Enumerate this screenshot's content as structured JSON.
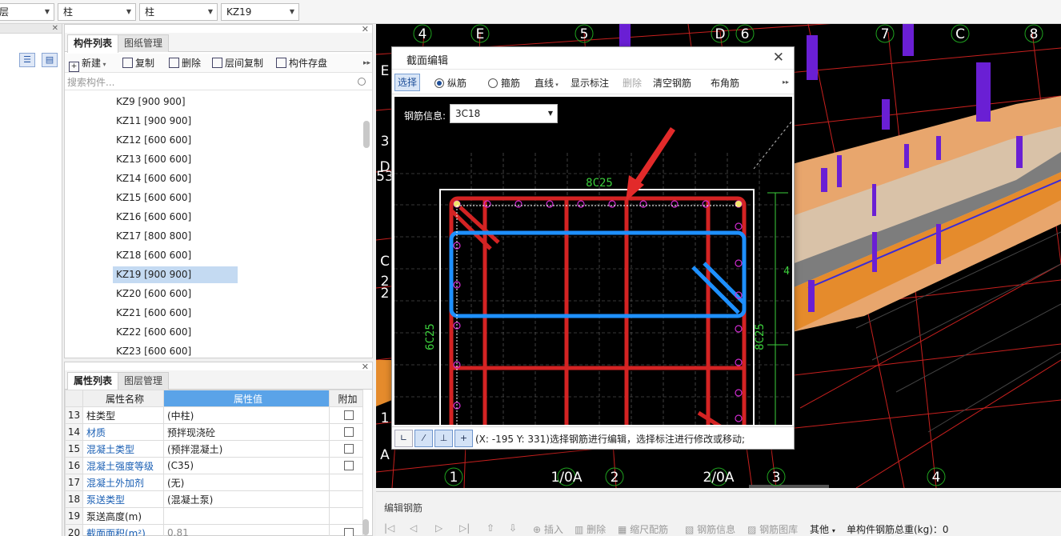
{
  "filters": {
    "combo1": "层",
    "combo2": "柱",
    "combo3": "柱",
    "combo4": "KZ19"
  },
  "component_panel": {
    "tabs": [
      "构件列表",
      "图纸管理"
    ],
    "toolbar": {
      "new": "新建",
      "copy": "复制",
      "delete": "删除",
      "layer_copy": "层间复制",
      "save": "构件存盘"
    },
    "search_placeholder": "搜索构件...",
    "items": [
      "KZ9 [900 900]",
      "KZ11 [900 900]",
      "KZ12 [600 600]",
      "KZ13 [600 600]",
      "KZ14 [600 600]",
      "KZ15 [600 600]",
      "KZ16 [600 600]",
      "KZ17 [800 800]",
      "KZ18 [600 600]",
      "KZ19 [900 900]",
      "KZ20 [600 600]",
      "KZ21 [600 600]",
      "KZ22 [600 600]",
      "KZ23 [600 600]"
    ],
    "selected_index": 9
  },
  "property_panel": {
    "tabs": [
      "属性列表",
      "图层管理"
    ],
    "headers": [
      "属性名称",
      "属性值",
      "附加"
    ],
    "rows": [
      {
        "num": "13",
        "name": "柱类型",
        "value": "(中柱)",
        "link": false,
        "checkbox": true
      },
      {
        "num": "14",
        "name": "材质",
        "value": "预拌现浇砼",
        "link": true,
        "checkbox": true
      },
      {
        "num": "15",
        "name": "混凝土类型",
        "value": "(预拌混凝土)",
        "link": true,
        "checkbox": true
      },
      {
        "num": "16",
        "name": "混凝土强度等级",
        "value": "(C35)",
        "link": true,
        "checkbox": true
      },
      {
        "num": "17",
        "name": "混凝土外加剂",
        "value": "(无)",
        "link": true,
        "checkbox": false
      },
      {
        "num": "18",
        "name": "泵送类型",
        "value": "(混凝土泵)",
        "link": true,
        "checkbox": false
      },
      {
        "num": "19",
        "name": "泵送高度(m)",
        "value": "",
        "link": false,
        "checkbox": false
      },
      {
        "num": "20",
        "name": "截面面积(m²)",
        "value": "0.81",
        "link": true,
        "checkbox": true
      }
    ]
  },
  "viewport": {
    "top_axis_labels": [
      "4",
      "E",
      "5",
      "D",
      "6",
      "7",
      "C",
      "8"
    ],
    "bottom_axis_labels": [
      "1",
      "1/0A",
      "2",
      "2/0A",
      "3",
      "4"
    ],
    "left_axis_labels": [
      "E",
      "3",
      "D",
      "53",
      "C",
      "2",
      "2",
      "1",
      "A"
    ]
  },
  "dialog": {
    "title": "截面编辑",
    "toolbar": {
      "select": "选择",
      "longitudinal": "纵筋",
      "stirrup": "箍筋",
      "line": "直线",
      "show_annotation": "显示标注",
      "delete": "删除",
      "clear": "清空钢筋",
      "corner": "布角筋"
    },
    "rebar_info_label": "钢筋信息:",
    "rebar_info_value": "3C18",
    "annotations": {
      "top": "8C25",
      "left": "6C25",
      "right": "8C25",
      "right_dim": "4"
    },
    "status": "(X: -195 Y: 331)选择钢筋进行编辑，选择标注进行修改或移动;",
    "colors": {
      "rebar_red": "#d42323",
      "stirrup_blue": "#1e90ff",
      "dim_green": "#3ccf3c",
      "bar_magenta": "#d02bd0"
    }
  },
  "edit_panel": {
    "title": "编辑钢筋",
    "tools": [
      "插入",
      "删除",
      "缩尺配筋",
      "钢筋信息",
      "钢筋图库",
      "其他"
    ],
    "weight_label": "单构件钢筋总重(kg)：0"
  }
}
